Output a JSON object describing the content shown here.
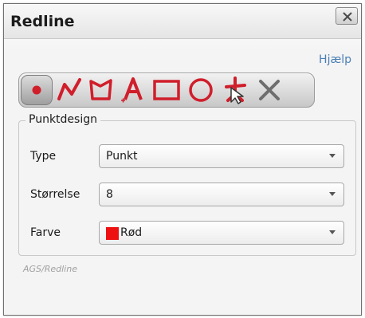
{
  "window": {
    "title": "Redline",
    "close_label": "Close"
  },
  "help": {
    "label": "Hjælp"
  },
  "toolbar": {
    "accent_color": "#d01e2b",
    "tools": [
      {
        "icon": "point-icon",
        "active": true
      },
      {
        "icon": "polyline-icon",
        "active": false
      },
      {
        "icon": "polygon-icon",
        "active": false
      },
      {
        "icon": "text-icon",
        "active": false
      },
      {
        "icon": "rectangle-icon",
        "active": false
      },
      {
        "icon": "circle-icon",
        "active": false
      },
      {
        "icon": "move-icon",
        "active": false
      },
      {
        "icon": "delete-icon",
        "active": false
      }
    ]
  },
  "design": {
    "legend": "Punktdesign",
    "type": {
      "label": "Type",
      "value": "Punkt"
    },
    "size": {
      "label": "Størrelse",
      "value": "8"
    },
    "color": {
      "label": "Farve",
      "value": "Rød",
      "swatch": "#ee1111"
    }
  },
  "footer": {
    "text": "AGS/Redline"
  }
}
